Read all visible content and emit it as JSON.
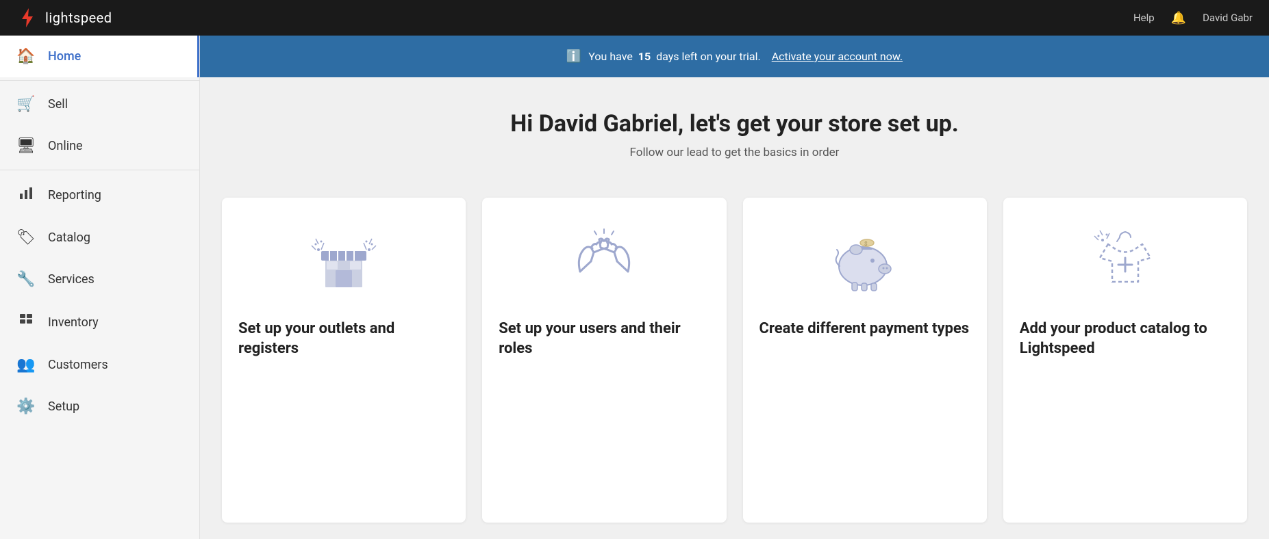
{
  "topNav": {
    "logoText": "lightspeed",
    "helpLabel": "Help",
    "userName": "David Gabr",
    "bellIcon": "🔔"
  },
  "sidebar": {
    "items": [
      {
        "id": "home",
        "label": "Home",
        "icon": "🏠",
        "active": true
      },
      {
        "id": "sell",
        "label": "Sell",
        "icon": "🛒",
        "active": false
      },
      {
        "id": "online",
        "label": "Online",
        "icon": "🖥",
        "active": false
      },
      {
        "id": "reporting",
        "label": "Reporting",
        "icon": "📊",
        "active": false
      },
      {
        "id": "catalog",
        "label": "Catalog",
        "icon": "🏷",
        "active": false
      },
      {
        "id": "services",
        "label": "Services",
        "icon": "🔧",
        "active": false
      },
      {
        "id": "inventory",
        "label": "Inventory",
        "icon": "📦",
        "active": false
      },
      {
        "id": "customers",
        "label": "Customers",
        "icon": "👥",
        "active": false
      },
      {
        "id": "setup",
        "label": "Setup",
        "icon": "⚙️",
        "active": false
      }
    ]
  },
  "trialBanner": {
    "message": "You have",
    "days": "15",
    "suffix": "days left on your trial.",
    "ctaLabel": "Activate your account now."
  },
  "hero": {
    "heading": "Hi David Gabriel, let's get your store set up.",
    "subheading": "Follow our lead to get the basics in order"
  },
  "cards": [
    {
      "id": "outlets",
      "title": "Set up your outlets and registers"
    },
    {
      "id": "users",
      "title": "Set up your users and their roles"
    },
    {
      "id": "payment",
      "title": "Create different payment types"
    },
    {
      "id": "catalog",
      "title": "Add your product catalog to Lightspeed"
    }
  ]
}
